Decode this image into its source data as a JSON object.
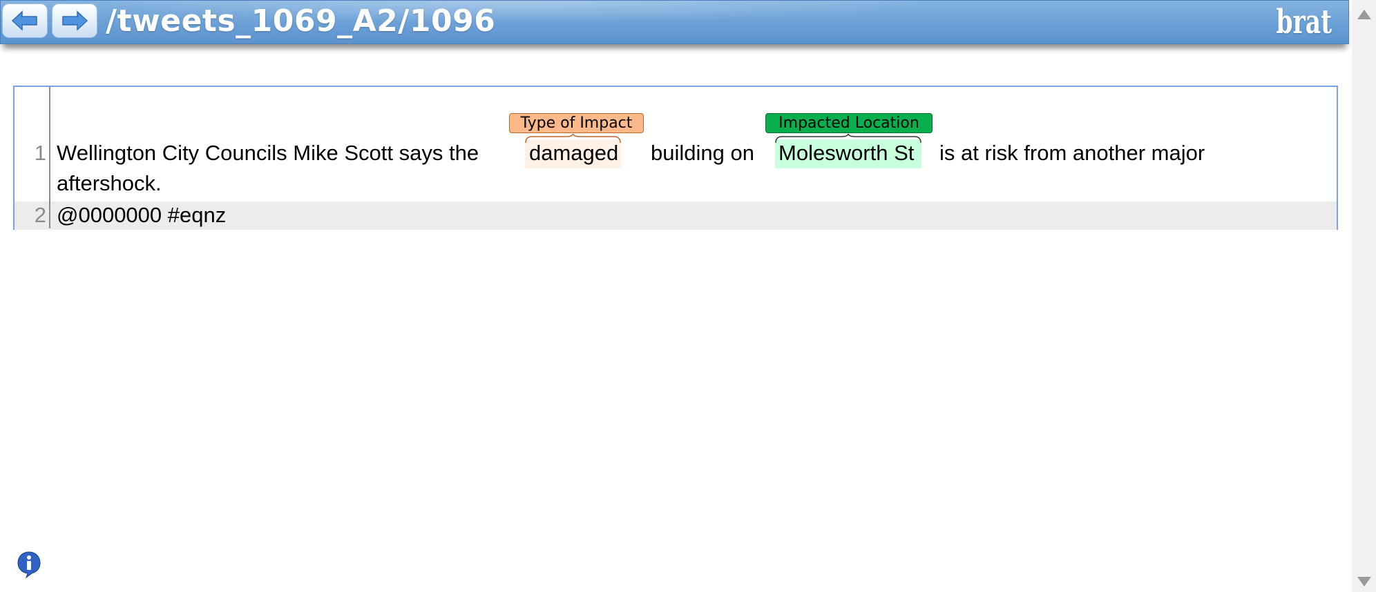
{
  "header": {
    "doc_path": "/tweets_1069_A2/1096",
    "logo": "brat",
    "prev_icon": "arrow-left-icon",
    "next_icon": "arrow-right-icon"
  },
  "document": {
    "lines": [
      {
        "number": "1",
        "segments": {
          "before": "Wellington City Councils Mike Scott says the",
          "impact_text": "damaged",
          "middle": "building on",
          "location_text": "Molesworth St",
          "after": "is at risk from another major",
          "wrap": "aftershock."
        }
      },
      {
        "number": "2",
        "text": "@0000000 #eqnz"
      }
    ],
    "annotations": [
      {
        "label": "Type of Impact",
        "text": "damaged",
        "color": "#fbb98a"
      },
      {
        "label": "Impacted Location",
        "text": "Molesworth St",
        "color": "#0aaf4d"
      }
    ]
  },
  "footer": {
    "info_icon": "info-icon"
  },
  "colors": {
    "header_blue": "#6fa3d8",
    "panel_border": "#7a9ef0",
    "impact_label": "#fbb98a",
    "location_label": "#0aaf4d"
  }
}
